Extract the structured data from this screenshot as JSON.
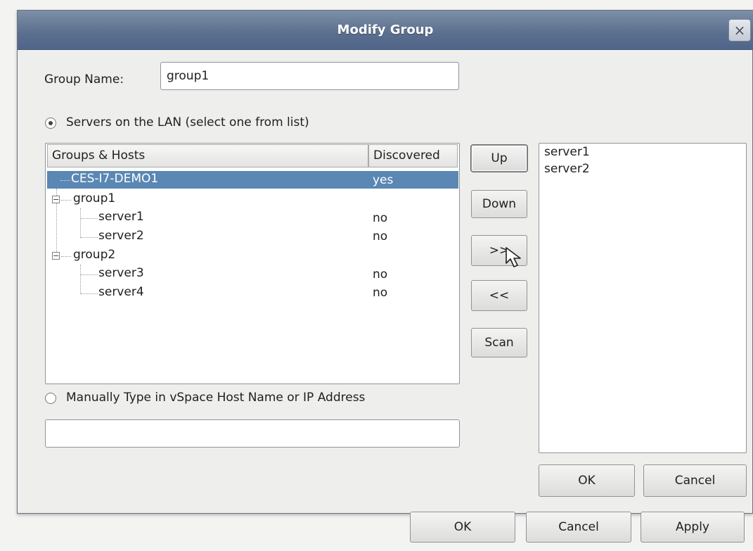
{
  "dialog": {
    "title": "Modify Group",
    "close_glyph": "×"
  },
  "group_name": {
    "label": "Group Name:",
    "value": "group1"
  },
  "lan_option": {
    "label": "Servers on the LAN (select one from list)",
    "selected": true
  },
  "tree": {
    "columns": [
      "Groups & Hosts",
      "Discovered"
    ],
    "rows": [
      {
        "name": "CES-I7-DEMO1",
        "discovered": "yes",
        "selected": true
      },
      {
        "name": "group1",
        "discovered": "",
        "expander": "−"
      },
      {
        "name": "server1",
        "discovered": "no"
      },
      {
        "name": "server2",
        "discovered": "no"
      },
      {
        "name": "group2",
        "discovered": "",
        "expander": "−"
      },
      {
        "name": "server3",
        "discovered": "no"
      },
      {
        "name": "server4",
        "discovered": "no"
      }
    ]
  },
  "side_buttons": {
    "up": "Up",
    "down": "Down",
    "add": ">>",
    "remove": "<<",
    "scan": "Scan"
  },
  "group_members": [
    "server1",
    "server2"
  ],
  "manual_option": {
    "label": "Manually Type in vSpace Host Name or IP Address",
    "selected": false,
    "value": ""
  },
  "inner_buttons": {
    "ok": "OK",
    "cancel": "Cancel"
  },
  "footer_buttons": {
    "ok": "OK",
    "cancel": "Cancel",
    "apply": "Apply"
  },
  "colors": {
    "title_bar": "#5a6f8e",
    "selection": "#5a87b3",
    "dialog_bg": "#eeeeec"
  }
}
